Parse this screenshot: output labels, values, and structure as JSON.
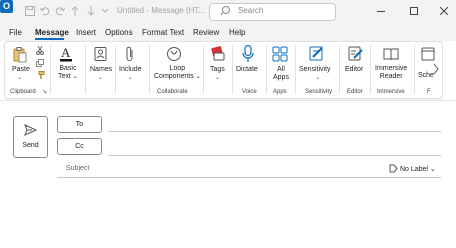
{
  "titlebar": {
    "title": "Untitled - Message (HT...",
    "search_placeholder": "Search",
    "app_icon_letter": "O"
  },
  "menu": {
    "tabs": [
      "File",
      "Message",
      "Insert",
      "Options",
      "Format Text",
      "Review",
      "Help"
    ],
    "active": "Message"
  },
  "ribbon": {
    "paste": "Paste",
    "basic_text": [
      "Basic",
      "Text"
    ],
    "names": "Names",
    "include": "Include",
    "loop_components": [
      "Loop",
      "Components"
    ],
    "tags": "Tags",
    "dictate": "Dictate",
    "all_apps": [
      "All",
      "Apps"
    ],
    "sensitivity": "Sensitivity",
    "editor": "Editor",
    "immersive_reader": [
      "Immersive",
      "Reader"
    ],
    "schedule": "Sche",
    "groups": {
      "clipboard": "Clipboard",
      "collaborate": "Collaborate",
      "voice": "Voice",
      "apps": "Apps",
      "sensitivity": "Sensitivity",
      "editor": "Editor",
      "immersive": "Immersive",
      "last": "F"
    }
  },
  "compose": {
    "send": "Send",
    "to": "To",
    "cc": "Cc",
    "subject": "Subject",
    "sensitivity_label": "No Label"
  },
  "colors": {
    "accent": "#0f6cbd",
    "titlebar_bg": "#f3f3f3"
  }
}
